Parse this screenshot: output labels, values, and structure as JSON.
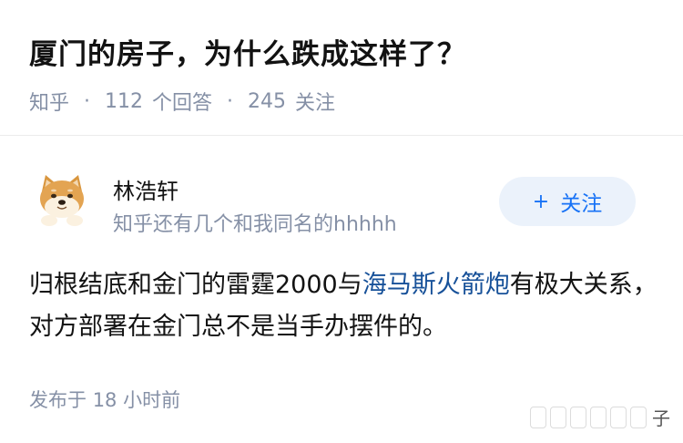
{
  "question": {
    "title": "厦门的房子，为什么跌成这样了？",
    "source": "知乎",
    "answers_count": "112",
    "answers_label": "个回答",
    "followers_count": "245",
    "followers_label": "关注"
  },
  "answer": {
    "author": {
      "name": "林浩轩",
      "bio": "知乎还有几个和我同名的hhhhh",
      "avatar_icon": "doge-avatar-icon"
    },
    "follow_button": {
      "icon": "+",
      "label": "关注"
    },
    "body": {
      "text_before": "归根结底和金门的雷霆2000与",
      "link_text": "海马斯火箭炮",
      "text_after": "有极大关系，对方部署在金门总不是当手办摆件的。"
    },
    "publish_label": "发布于",
    "publish_time": "18 小时前"
  },
  "watermark": {
    "text": "子"
  },
  "colors": {
    "link_blue": "#175199",
    "follow_blue": "#1772f6",
    "follow_bg": "#ebf2fb",
    "meta_grey": "#8590a6"
  }
}
